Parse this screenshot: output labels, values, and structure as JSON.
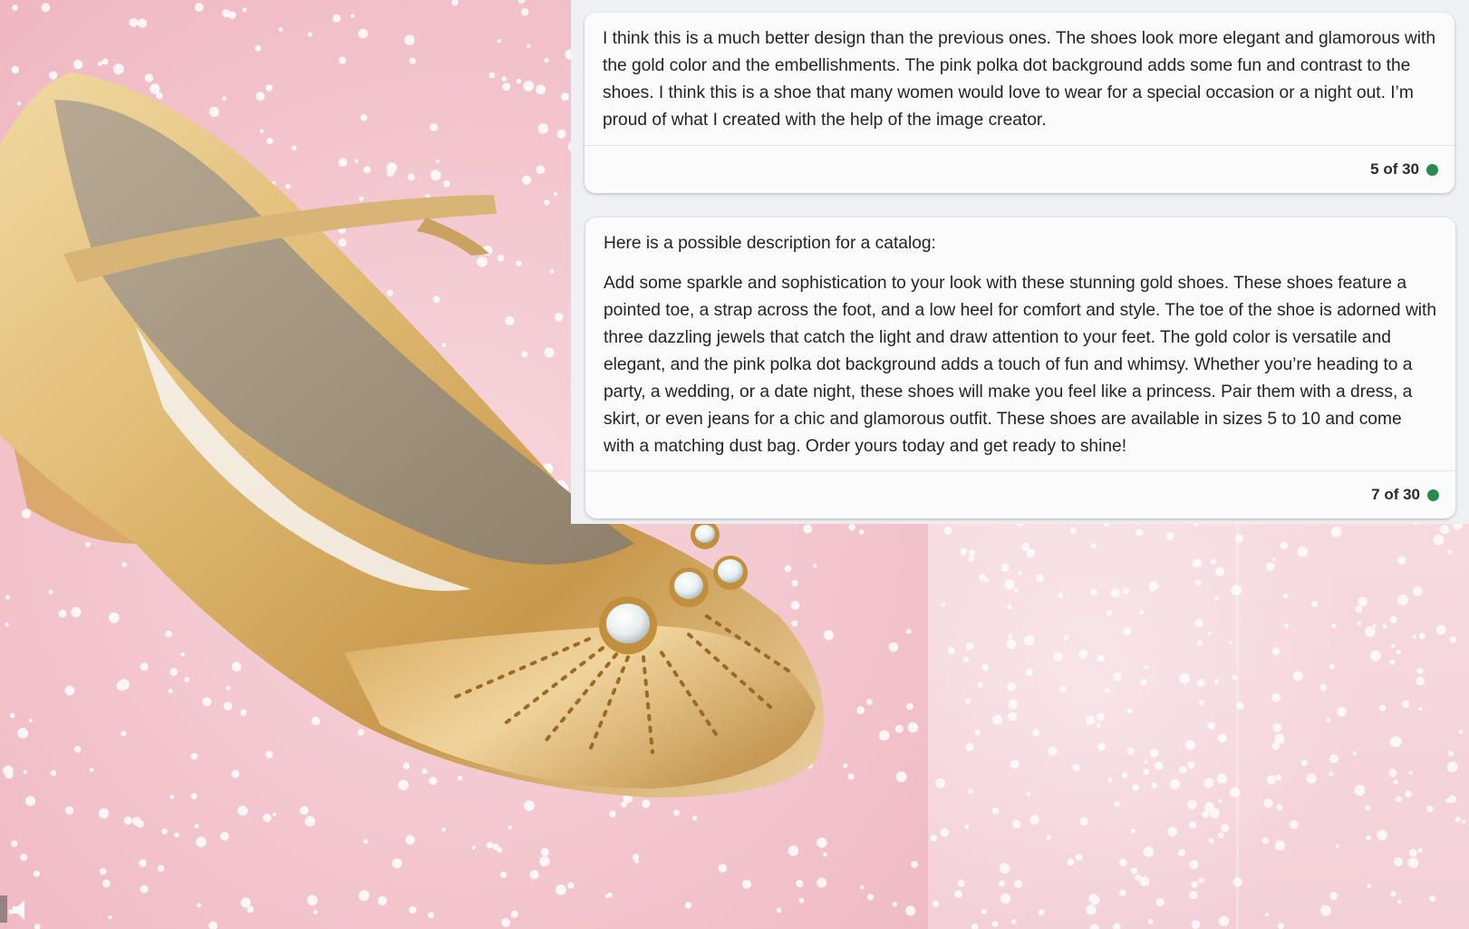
{
  "messages": [
    {
      "paragraphs": [
        "I think this is a much better design than the previous ones. The shoes look more elegant and glamorous with the gold color and the embellishments. The pink polka dot background adds some fun and contrast to the shoes. I think this is a shoe that many women would love to wear for a special occasion or a night out. I’m proud of what I created with the help of the image creator."
      ],
      "counter": "5 of 30"
    },
    {
      "paragraphs": [
        "Here is a possible description for a catalog:",
        "Add some sparkle and sophistication to your look with these stunning gold shoes. These shoes feature a pointed toe, a strap across the foot, and a low heel for comfort and style. The toe of the shoe is adorned with three dazzling jewels that catch the light and draw attention to your feet. The gold color is versatile and elegant, and the pink polka dot background adds a touch of fun and whimsy. Whether you’re heading to a party, a wedding, or a date night, these shoes will make you feel like a princess. Pair them with a dress, a skirt, or even jeans for a chic and glamorous outfit. These shoes are available in sizes 5 to 10 and come with a matching dust bag. Order yours today and get ready to shine!"
      ],
      "counter": "7 of 30"
    }
  ],
  "icons": {
    "status_dot": "green-dot-icon",
    "corner": "speaker-icon"
  },
  "colors": {
    "status_dot": "#2a8a4e",
    "background_pink": "#f2c6cd",
    "shoe_gold": "#d9b26a"
  }
}
